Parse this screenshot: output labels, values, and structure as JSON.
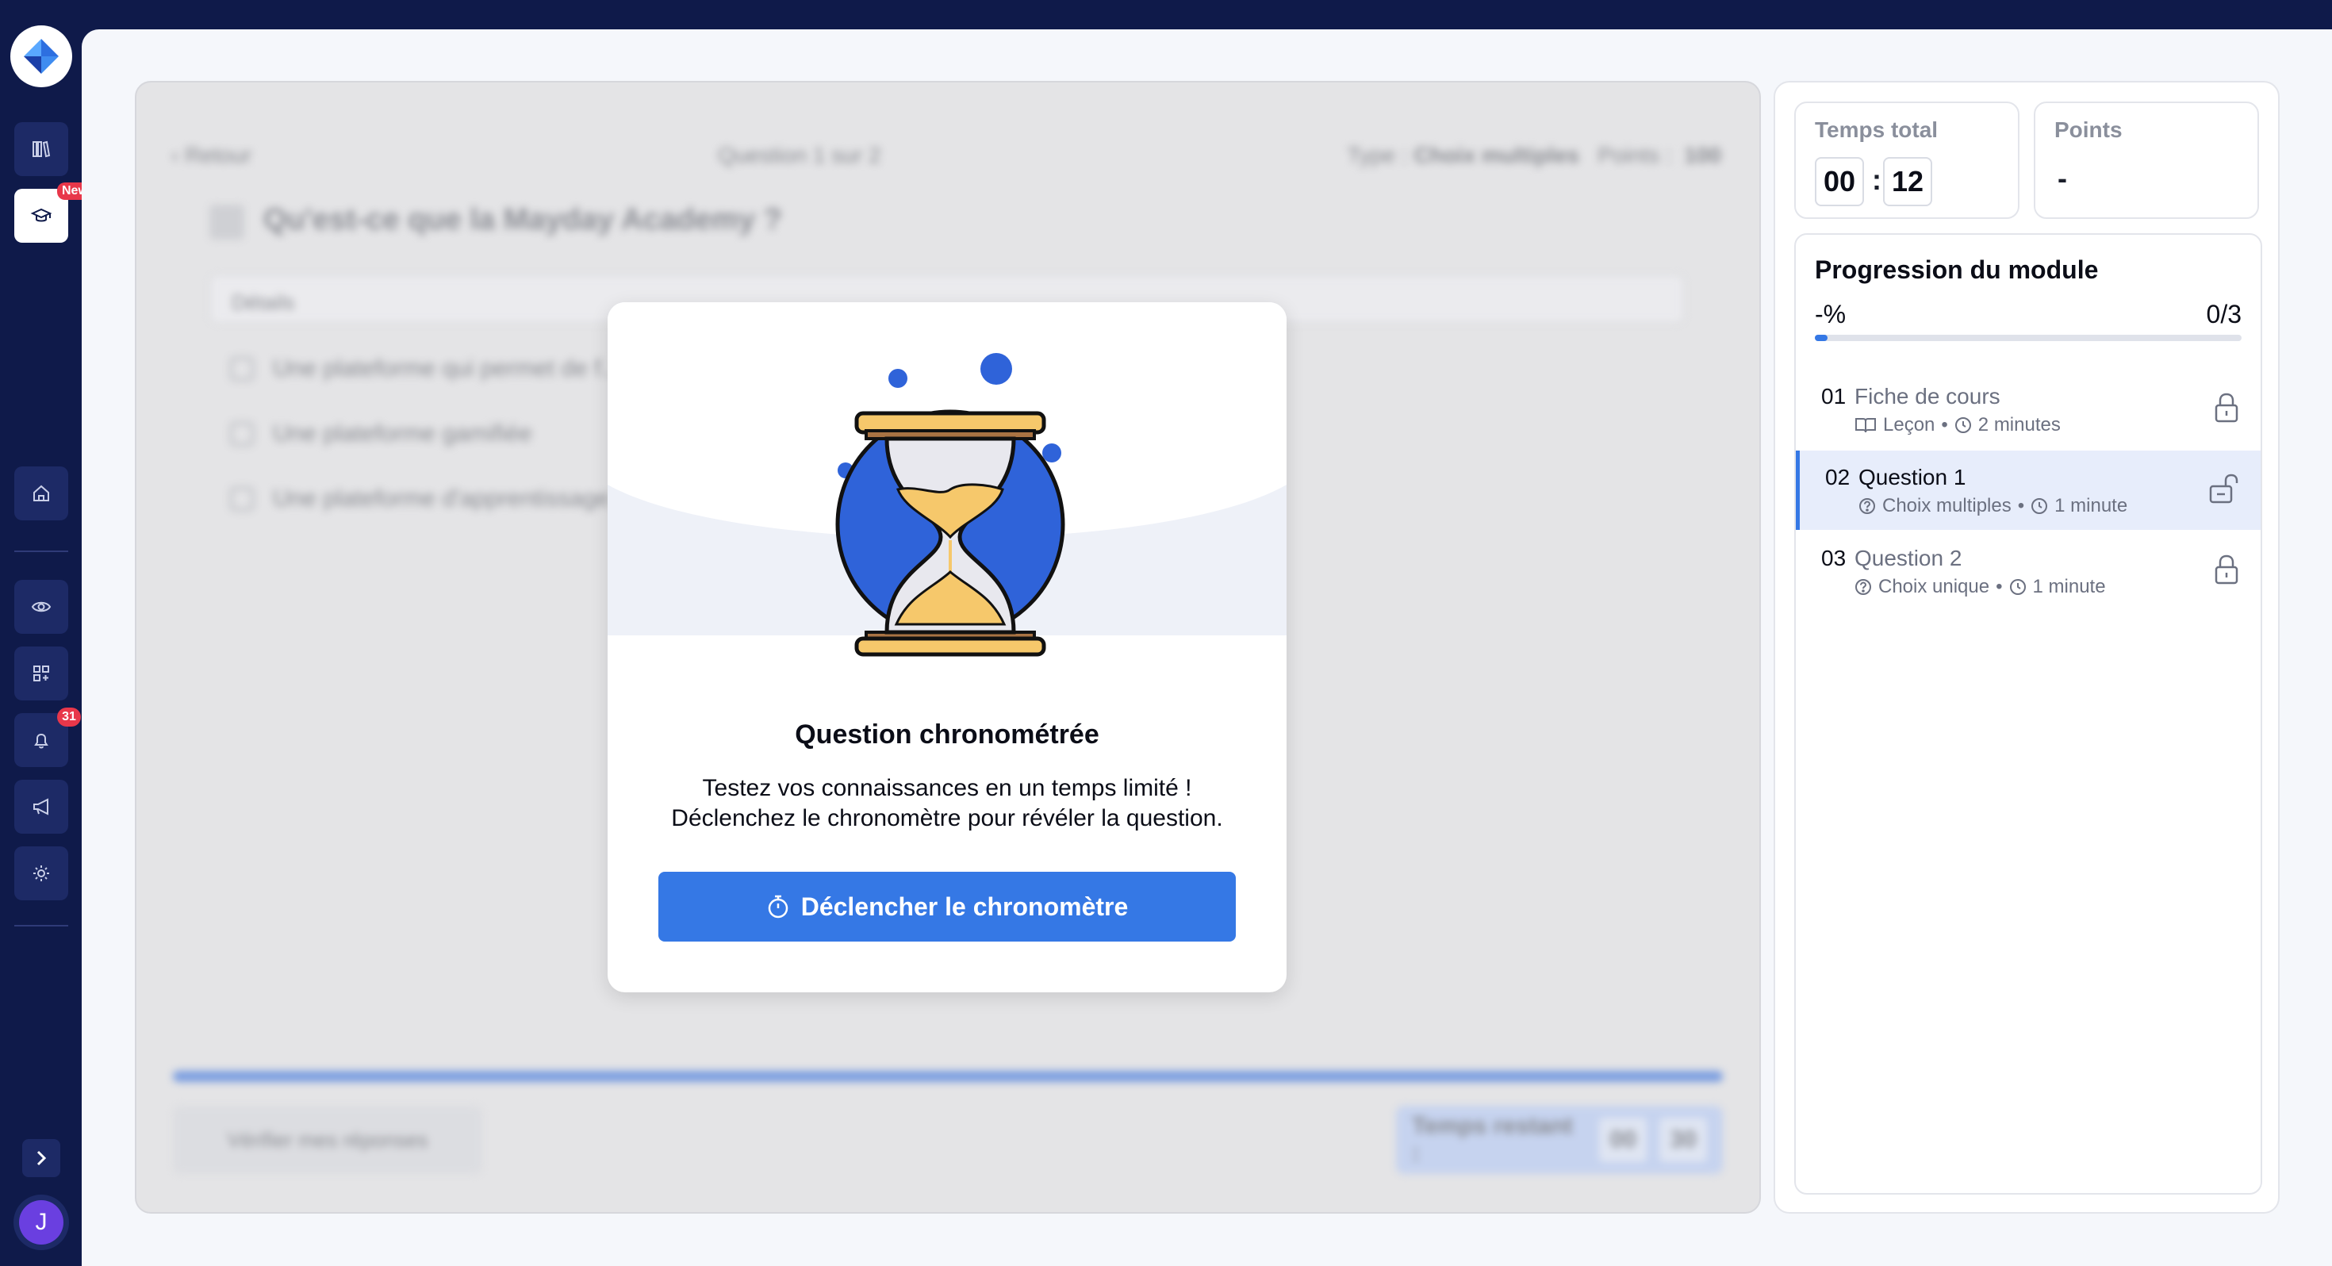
{
  "sidebar": {
    "new_badge": "New",
    "notification_count": "31",
    "avatar_initial": "J"
  },
  "question_panel": {
    "back_label": "Retour",
    "question_counter": "Question 1 sur 2",
    "type_label": "Type :",
    "type_value": "Choix multiples",
    "points_label": "Points :",
    "points_value": "100",
    "title": "Qu'est-ce que la Mayday Academy ?",
    "details_label": "Détails",
    "options": [
      "Une plateforme qui permet de f...",
      "Une plateforme gamifiée",
      "Une plateforme d'apprentissage..."
    ],
    "verify_button": "Vérifier mes réponses",
    "remaining_label": "Temps restant :",
    "remaining_min": "00",
    "remaining_sec": "30"
  },
  "modal": {
    "title": "Question chronométrée",
    "desc_line1": "Testez vos connaissances en un temps limité !",
    "desc_line2": "Déclenchez le chronomètre pour révéler la question.",
    "button_label": "Déclencher le chronomètre",
    "colors": {
      "accent": "#3578e5",
      "sand": "#f6c86b"
    }
  },
  "stats": {
    "time_label": "Temps total",
    "time_min": "00",
    "time_sec": "12",
    "points_label": "Points",
    "points_value": "-"
  },
  "progress": {
    "title": "Progression du module",
    "percent": "-%",
    "count": "0/3",
    "fill_fraction": 0.0
  },
  "lessons": [
    {
      "num": "01",
      "title": "Fiche de cours",
      "type": "Leçon",
      "duration": "2 minutes",
      "type_icon": "book-icon",
      "locked": true,
      "active": false
    },
    {
      "num": "02",
      "title": "Question 1",
      "type": "Choix multiples",
      "duration": "1 minute",
      "type_icon": "question-icon",
      "locked": false,
      "active": true
    },
    {
      "num": "03",
      "title": "Question 2",
      "type": "Choix unique",
      "duration": "1 minute",
      "type_icon": "question-icon",
      "locked": true,
      "active": false
    }
  ]
}
